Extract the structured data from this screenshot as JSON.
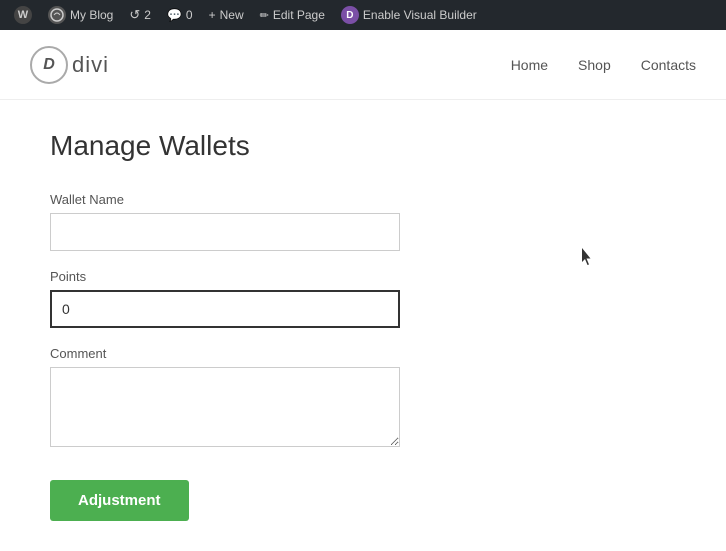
{
  "adminBar": {
    "items": [
      {
        "id": "wp-logo",
        "label": "",
        "icon": "W"
      },
      {
        "id": "my-blog",
        "label": "My Blog",
        "icon": "MB"
      },
      {
        "id": "updates",
        "label": "2",
        "icon": "↺"
      },
      {
        "id": "comments",
        "label": "0",
        "icon": "💬"
      },
      {
        "id": "new",
        "label": "New",
        "icon": "+"
      },
      {
        "id": "edit-page",
        "label": "Edit Page",
        "icon": "✏"
      },
      {
        "id": "divi",
        "label": "Enable Visual Builder",
        "icon": "D"
      }
    ]
  },
  "siteHeader": {
    "logoLetter": "D",
    "logoName": "divi",
    "navItems": [
      "Home",
      "Shop",
      "Contacts"
    ]
  },
  "form": {
    "pageTitle": "Manage Wallets",
    "walletNameLabel": "Wallet Name",
    "walletNamePlaceholder": "",
    "walletNameValue": "",
    "pointsLabel": "Points",
    "pointsValue": "0",
    "commentLabel": "Comment",
    "commentValue": "",
    "commentPlaceholder": "",
    "adjustmentButtonLabel": "Adjustment"
  }
}
